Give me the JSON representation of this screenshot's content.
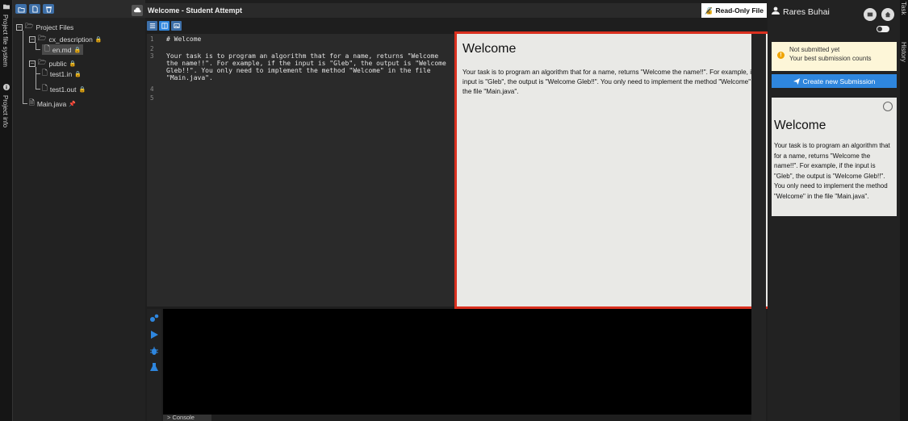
{
  "left_strip": {
    "project_file_system_label": "Project file system",
    "project_info_label": "Project info"
  },
  "file_tree": {
    "root": "Project Files",
    "items": [
      {
        "name": "cx_description",
        "type": "folder"
      },
      {
        "name": "en.md",
        "type": "file",
        "selected": true
      },
      {
        "name": "public",
        "type": "folder"
      },
      {
        "name": "test1.in",
        "type": "file"
      },
      {
        "name": "test1.out",
        "type": "file"
      },
      {
        "name": "Main.java",
        "type": "file"
      }
    ]
  },
  "topbar": {
    "title": "Welcome - Student Attempt",
    "read_only_label": "Read-Only File"
  },
  "editor": {
    "line_numbers": [
      "1",
      "2",
      "3",
      "",
      "",
      "4",
      "5"
    ],
    "lines": [
      "# Welcome",
      "",
      "Your task is to program an algorithm that for a name, returns \"Welcome",
      "the name!!\". For example, if the input is \"Gleb\", the output is \"Welcome",
      "Gleb!!\". You only need to implement the method \"Welcome\" in the file",
      "\"Main.java\"."
    ]
  },
  "preview": {
    "heading": "Welcome",
    "body": "Your task is to program an algorithm that for a name, returns \"Welcome the name!!\". For example, if the input is \"Gleb\", the output is \"Welcome Gleb!!\". You only need to implement the method \"Welcome\" in the file \"Main.java\"."
  },
  "console": {
    "tab_label": "> Console"
  },
  "right_panel": {
    "user_name": "Rares Buhai",
    "status_line1": "Not submitted yet",
    "status_line2": "Your best submission counts",
    "submit_label": "Create new Submission",
    "task_heading": "Welcome",
    "task_body": "Your task is to program an algorithm that for a name, returns \"Welcome the name!!\". For example, if the input is \"Gleb\", the output is \"Welcome Gleb!!\". You only need to implement the method \"Welcome\" in the file \"Main.java\"."
  },
  "right_strip": {
    "task_label": "Task",
    "history_label": "History"
  },
  "colors": {
    "accent": "#2e86de",
    "highlight_border": "#d9301f",
    "warning": "#f0a500"
  }
}
